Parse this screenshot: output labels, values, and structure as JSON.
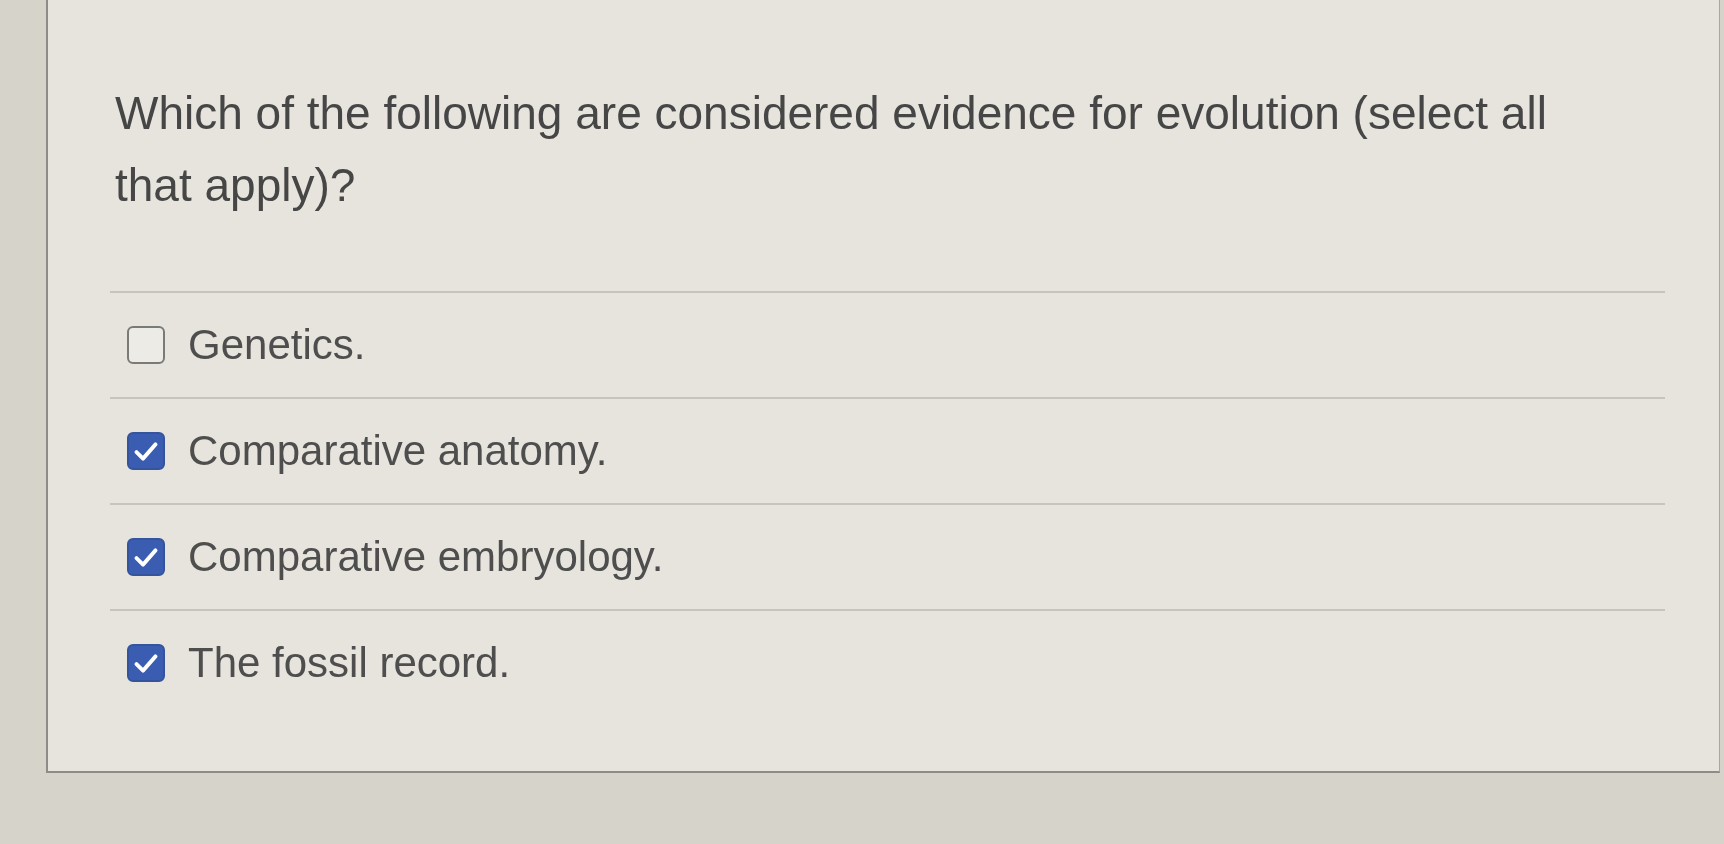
{
  "question": {
    "text": "Which of the following are considered evidence for evolution (select all that apply)?"
  },
  "options": [
    {
      "label": "Genetics.",
      "checked": false
    },
    {
      "label": "Comparative anatomy.",
      "checked": true
    },
    {
      "label": "Comparative embryology.",
      "checked": true
    },
    {
      "label": "The fossil record.",
      "checked": true
    }
  ]
}
